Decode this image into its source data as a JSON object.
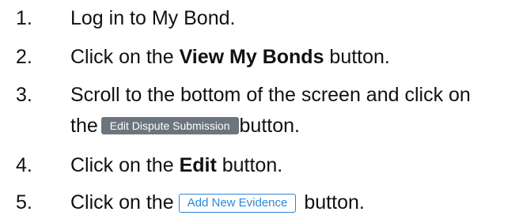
{
  "steps": [
    {
      "number": "1.",
      "text": "Log in to My Bond."
    },
    {
      "number": "2.",
      "before": "Click on the ",
      "bold": "View My Bonds",
      "after": " button."
    },
    {
      "number": "3.",
      "line1": "Scroll to the bottom of the screen and click on",
      "before": "the",
      "button": "Edit Dispute Submission",
      "after": "button."
    },
    {
      "number": "4.",
      "before": "Click on the ",
      "bold": "Edit",
      "after": " button."
    },
    {
      "number": "5.",
      "before": "Click on the",
      "button": "Add New Evidence",
      "after": "button."
    }
  ],
  "colors": {
    "grey_button_bg": "#6c757d",
    "outline_button_accent": "#2e86d6"
  }
}
